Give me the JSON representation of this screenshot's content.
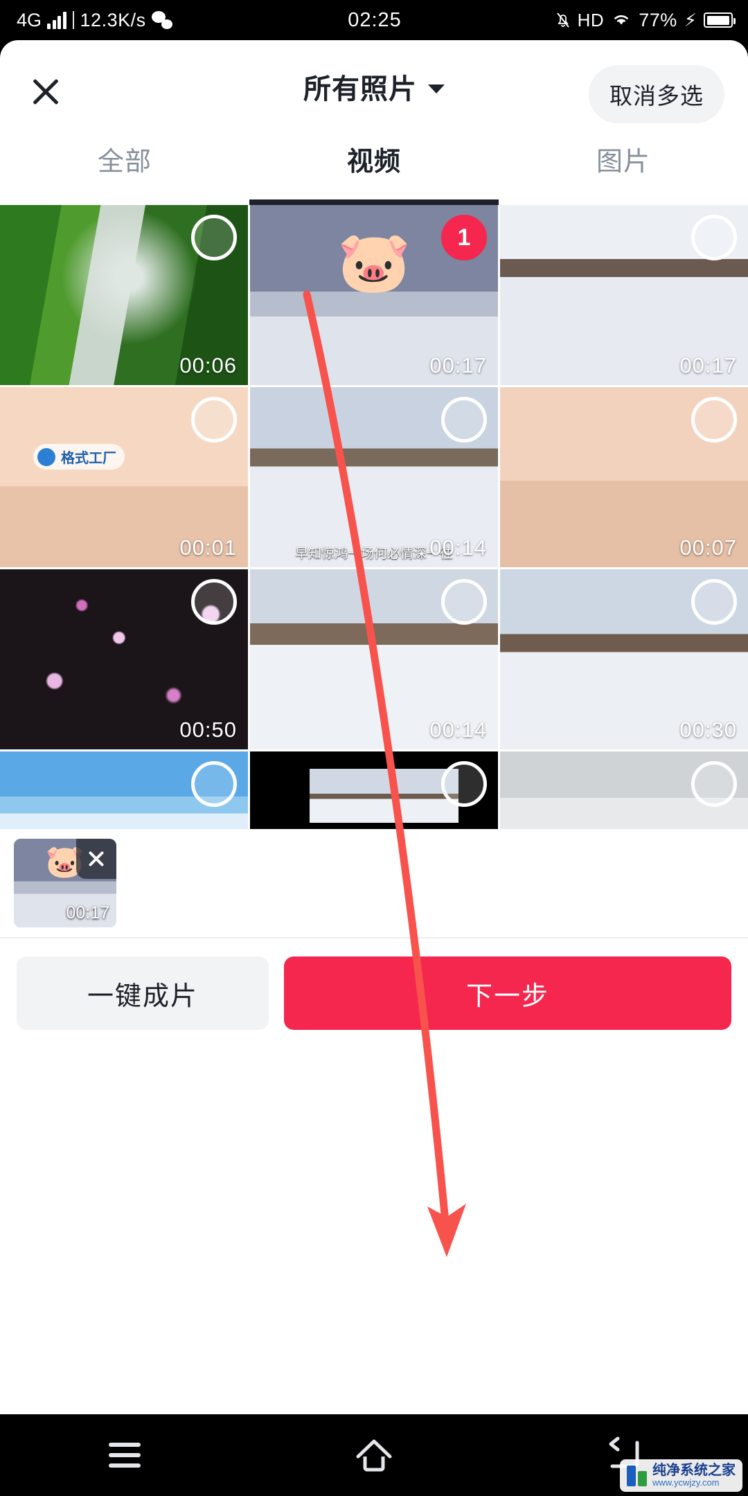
{
  "status_bar": {
    "network": "4G",
    "speed": "12.3K/s",
    "wechat_icon": "wechat-icon",
    "time": "02:25",
    "mute_icon": "mute-bell-icon",
    "hd": "HD",
    "wifi_icon": "wifi-icon",
    "battery": "77%",
    "charging_icon": "bolt-icon"
  },
  "header": {
    "close_icon": "close-icon",
    "title": "所有照片",
    "chevron_icon": "chevron-down-icon",
    "multiselect_button": "取消多选"
  },
  "tabs": [
    {
      "label": "全部",
      "active": false
    },
    {
      "label": "视频",
      "active": true
    },
    {
      "label": "图片",
      "active": false
    }
  ],
  "grid": {
    "items": [
      {
        "duration": "00:06",
        "selected": false,
        "thumb_class": "ph-waterfall",
        "overlay": "",
        "caption": ""
      },
      {
        "duration": "00:17",
        "selected": true,
        "badge": "1",
        "thumb_class": "ph-snowbridge",
        "overlay": "pig",
        "caption": ""
      },
      {
        "duration": "00:17",
        "selected": false,
        "thumb_class": "ph-snowbridge2",
        "overlay": "",
        "caption": ""
      },
      {
        "duration": "00:01",
        "selected": false,
        "thumb_class": "ph-sunsettrees",
        "overlay": "format-factory",
        "watermark_text": "格式工厂",
        "caption": ""
      },
      {
        "duration": "00:14",
        "selected": false,
        "thumb_class": "ph-snowrail",
        "overlay": "",
        "caption": "早知惊鸿一场何必情深一往"
      },
      {
        "duration": "00:07",
        "selected": false,
        "thumb_class": "ph-sunsettrees2",
        "overlay": "",
        "caption": ""
      },
      {
        "duration": "00:50",
        "selected": false,
        "thumb_class": "ph-blossom",
        "overlay": "",
        "caption": ""
      },
      {
        "duration": "00:14",
        "selected": false,
        "thumb_class": "ph-snowfence",
        "overlay": "",
        "caption": ""
      },
      {
        "duration": "00:30",
        "selected": false,
        "thumb_class": "ph-snowrail2",
        "overlay": "",
        "caption": ""
      },
      {
        "duration": "",
        "selected": false,
        "thumb_class": "ph-birds",
        "overlay": "",
        "caption": ""
      },
      {
        "duration": "",
        "selected": false,
        "thumb_class": "ph-letterbox",
        "overlay": "",
        "caption": ""
      },
      {
        "duration": "",
        "selected": false,
        "thumb_class": "ph-fog",
        "overlay": "",
        "caption": ""
      }
    ]
  },
  "tray": {
    "selected_thumb": {
      "duration": "00:17",
      "overlay": "pig",
      "remove_icon": "close-icon"
    }
  },
  "actions": {
    "secondary_label": "一键成片",
    "primary_label": "下一步"
  },
  "annotation": {
    "arrow_color": "#F8524D"
  },
  "nav_bar": {
    "menu_icon": "menu-icon",
    "home_icon": "home-icon",
    "back_icon": "back-icon"
  },
  "watermark": {
    "line1": "纯净系统之家",
    "line2": "www.ycwjzy.com"
  },
  "colors": {
    "accent_red": "#F5274E",
    "text_primary": "#1D2129",
    "text_muted": "#86909C",
    "chip_bg": "#F2F3F5"
  }
}
